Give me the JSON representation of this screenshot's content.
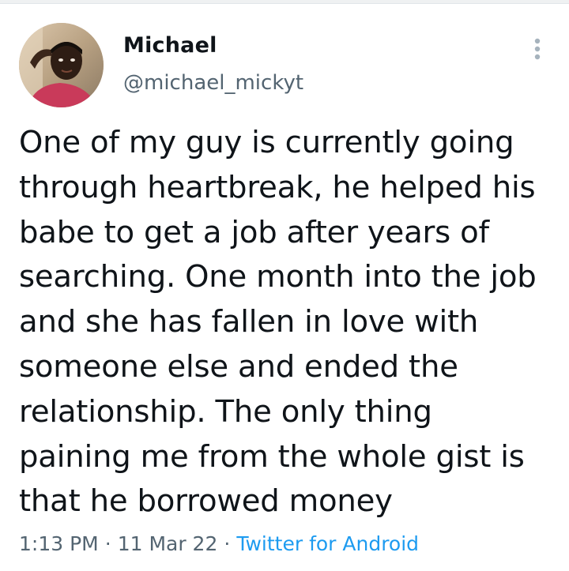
{
  "tweet": {
    "author": {
      "display_name": "Michael",
      "handle": "@michael_mickyt",
      "avatar_icon": "profile-photo"
    },
    "more_icon": "vertical-ellipsis-icon",
    "text": "One of my guy is currently going\nthrough heartbreak, he helped his\nbabe to get a job after years of\nsearching. One month into the job\nand she has fallen in love with\nsomeone else and ended the\nrelationship. The only thing\npaining me from the whole gist is\nthat he borrowed money",
    "time": "1:13 PM",
    "separator_1": "·",
    "date": "11 Mar 22",
    "separator_2": "·",
    "source": "Twitter for Android"
  },
  "colors": {
    "text": "#0f1419",
    "secondary": "#536471",
    "link": "#1d9bf0",
    "background": "#ffffff"
  }
}
